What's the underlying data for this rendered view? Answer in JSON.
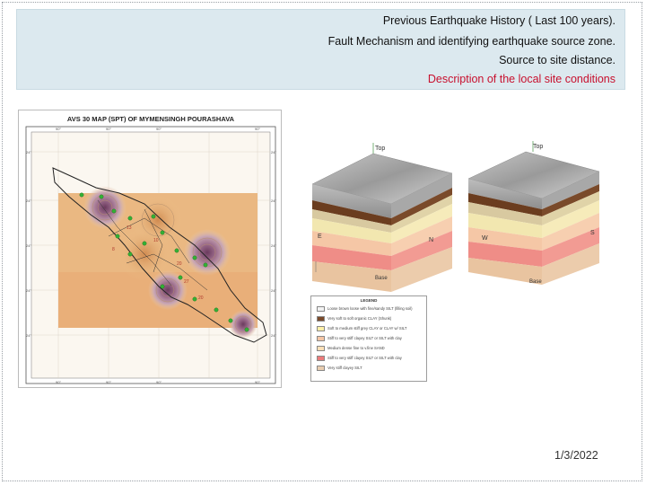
{
  "header": {
    "line1": "Previous Earthquake History ( Last 100 years).",
    "line2": "Fault Mechanism and identifying earthquake source zone.",
    "line3": "Source to site distance.",
    "line4": "Description of the local site conditions",
    "line4_color": "#c8102e",
    "box_color": "#dce9ef"
  },
  "map": {
    "title": "AVS 30 MAP (SPT) OF MYMENSINGH POURASHAVA",
    "top_ticks": [
      "90°",
      "90°",
      "90°",
      "90°"
    ],
    "left_ticks": [
      "24°",
      "24°",
      "24°",
      "24°",
      "24°"
    ],
    "right_ticks": [
      "24°",
      "24°",
      "24°",
      "24°",
      "24°"
    ],
    "value_labels": [
      "10",
      "8",
      "13",
      "20",
      "27",
      "20"
    ]
  },
  "geo": {
    "labels": {
      "top_left": "Top",
      "top_right": "Top",
      "e": "E",
      "n": "N",
      "w": "W",
      "s": "S",
      "base_left": "Base",
      "base_right": "Base"
    },
    "legend_title": "LEGEND",
    "legend_items": [
      {
        "color": "#f2f2f2",
        "text": "Loose brown loose with fine/sandy SILT (filling soil)"
      },
      {
        "color": "#7a4a2a",
        "text": "Very soft to soft organic CLAY (Shunk)"
      },
      {
        "color": "#fff0a8",
        "text": "Soft to medium stiff grey CLAY or CLAY w/ SILT"
      },
      {
        "color": "#f6c6a6",
        "text": "Stiff to very stiff clayey SILT or SILT with clay"
      },
      {
        "color": "#fde0b8",
        "text": "Medium dense fine to v.fine SAND"
      },
      {
        "color": "#ec7b7b",
        "text": "Stiff to very stiff clayey SILT or SILT with clay"
      },
      {
        "color": "#e9cdb0",
        "text": "Very stiff clayey SILT"
      }
    ]
  },
  "footer": {
    "date": "1/3/2022"
  }
}
